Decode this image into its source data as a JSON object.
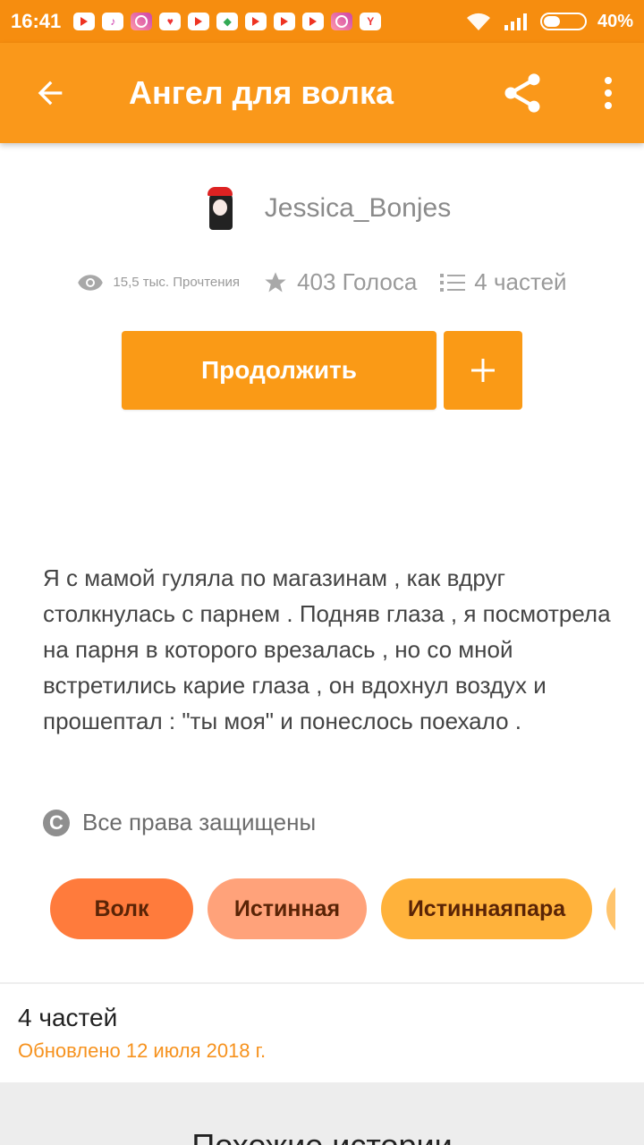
{
  "status_bar": {
    "time": "16:41",
    "battery": "40%",
    "battery_level": 0.4,
    "notifications": [
      "youtube-icon",
      "tiktok-icon",
      "instagram-icon",
      "heart-icon",
      "youtube-icon",
      "maps-icon",
      "youtube-icon",
      "youtube-icon",
      "youtube-icon",
      "instagram-icon",
      "yandex-icon"
    ]
  },
  "app_bar": {
    "title": "Ангел для волка",
    "color": "#fa981a"
  },
  "author": {
    "name": "Jessica_Bonjes"
  },
  "stats": {
    "reads": "15,5 тыс. Прочтения",
    "votes": "403 Голоса",
    "parts": "4 частей"
  },
  "actions": {
    "continue_label": "Продолжить",
    "add_label": "+"
  },
  "description": "Я с мамой гуляла по магазинам , как вдруг столкнулась с парнем . Подняв глаза , я посмотрела на парня в которого врезалась , но со мной встретились карие глаза , он вдохнул воздух и прошептал : \"ты моя\" и понеслось поехало .",
  "copyright": {
    "label": "Все права защищены"
  },
  "tags": [
    "Волк",
    "Истинная",
    "Истиннаяпара",
    ""
  ],
  "parts_section": {
    "title": "4 частей",
    "updated": "Обновлено 12 июля 2018 г."
  },
  "similar": {
    "title": "Похожие истории"
  }
}
